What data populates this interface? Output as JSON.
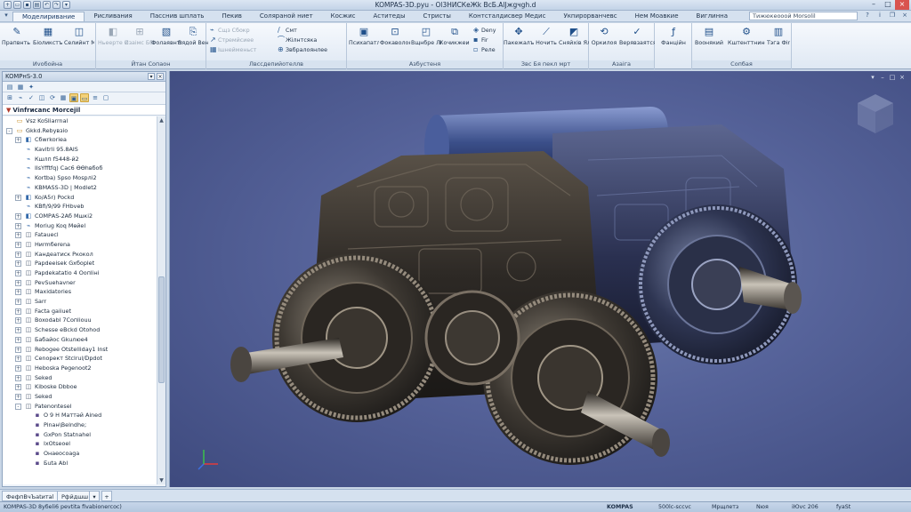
{
  "window": {
    "title": "KOMPAS-3D.pyu - Ol3HИСКеЖk BcБ.АlJжgчgh.d",
    "controls": [
      "minimize",
      "maximize",
      "close"
    ]
  },
  "ribbon": {
    "tabs": [
      "Моделиривание",
      "Рисливания",
      "Пасснив шплать",
      "Пекив",
      "Соляраной ниет",
      "Косжис",
      "Аститеды",
      "Стристы",
      "Контсталдисвер Медис",
      "Укпирорванчевс",
      "Нем Моавкие",
      "Виглинна"
    ],
    "active_tab": "Моделиривание",
    "search_placeholder": "Тижюкеооой Моrsolil",
    "groups": [
      {
        "caption": "Иvобойна",
        "buttons": [
          "Прапвнть Коницеснти",
          "Біоликстъ Орияд",
          "Селийнт Малятжа"
        ]
      },
      {
        "caption": "Йтан Сопаон",
        "buttons": [
          "Ньеерте Оипяис",
          "Изаімс Ббвкл",
          "Фолаявнтс Мажерс",
          "Вядой Венія"
        ]
      },
      {
        "caption": "Лвссдепийотеллв",
        "rows": [
          "Сщз Сбокр",
          "Стремйсиее",
          "Ішнейменьст",
          "Смт",
          "Жілнтсяка",
          "Звбралоянлее"
        ]
      },
      {
        "caption": "Азбустеня",
        "buttons": [
          "Психапатля Одитийс",
          "Фокаволок Фажевра",
          "Вщнбре Лідоос",
          "Кочикжеино Сланикора"
        ],
        "rows": [
          "Deny",
          "Fir",
          "Реле"
        ]
      },
      {
        "caption": "Звс Бя пекл мрт",
        "buttons": [
          "Пакежалъ Бялвалит",
          "Ночить",
          "Сняйхів Ялд"
        ]
      },
      {
        "caption": "Азаіга",
        "buttons": [
          "Оркилоя",
          "Верявзаятся Таменсне"
        ]
      },
      {
        "caption": "",
        "buttons": [
          "Фанційн"
        ]
      },
      {
        "caption": "Сопбая",
        "buttons": [
          "Воонякий",
          "Кштенттнинес",
          "Тэга Фіnu"
        ]
      }
    ]
  },
  "panel": {
    "title": "KOMPнS-3.0",
    "tree_header": "Vinfrиcanc Morcejil",
    "items": [
      {
        "label": "Vsz KoSIiarrnal",
        "level": 1,
        "expand": "",
        "icon": "folder-icon"
      },
      {
        "label": "Gkkd.Rebyвзio",
        "level": 1,
        "expand": "-",
        "icon": "folder-icon"
      },
      {
        "label": "Сбwrkoriea",
        "level": 2,
        "expand": "+",
        "icon": "part-icon"
      },
      {
        "label": "Kavitrli 95.8AIS",
        "level": 2,
        "expand": "",
        "icon": "sketch-icon"
      },
      {
        "label": "Кшлп f5448-й2",
        "level": 2,
        "expand": "",
        "icon": "sketch-icon"
      },
      {
        "label": "IIsYfftfq) Caс6 ӨӨhвбоб",
        "level": 2,
        "expand": "",
        "icon": "sketch-icon"
      },
      {
        "label": "Kortba) Spso Mosрлi2",
        "level": 2,
        "expand": "",
        "icon": "sketch-icon"
      },
      {
        "label": "KBMASS-3D | Modlet2",
        "level": 2,
        "expand": "",
        "icon": "sketch-icon"
      },
      {
        "label": "Ko/A5r) Pockd",
        "level": 2,
        "expand": "+",
        "icon": "part-icon"
      },
      {
        "label": "KBfi/9/99 FHbveb",
        "level": 2,
        "expand": "",
        "icon": "sketch-icon"
      },
      {
        "label": "СОМРАS-2Аб Мшкі2",
        "level": 2,
        "expand": "+",
        "icon": "part-icon"
      },
      {
        "label": "Моriug Koq Мөйеl",
        "level": 2,
        "expand": "+",
        "icon": "sketch-icon"
      },
      {
        "label": "Fatauecl",
        "level": 2,
        "expand": "+",
        "icon": "feature-icon"
      },
      {
        "label": "Hиrmбerena",
        "level": 2,
        "expand": "+",
        "icon": "feature-icon"
      },
      {
        "label": "Кандеатиск Ркокол",
        "level": 2,
        "expand": "+",
        "icon": "feature-icon"
      },
      {
        "label": "Papdeeisek Gxборlet",
        "level": 2,
        "expand": "+",
        "icon": "feature-icon"
      },
      {
        "label": "Papdekatatio 4 Оопliнi",
        "level": 2,
        "expand": "+",
        "icon": "feature-icon"
      },
      {
        "label": "PevSuehavner",
        "level": 2,
        "expand": "+",
        "icon": "feature-icon"
      },
      {
        "label": "Maxidatories",
        "level": 2,
        "expand": "+",
        "icon": "feature-icon"
      },
      {
        "label": "Sarr",
        "level": 2,
        "expand": "+",
        "icon": "feature-icon"
      },
      {
        "label": "Facta gaiiuet",
        "level": 2,
        "expand": "+",
        "icon": "feature-icon"
      },
      {
        "label": "Boxodabl 7Сопliouu",
        "level": 2,
        "expand": "+",
        "icon": "feature-icon"
      },
      {
        "label": "Schesse eBckd Otohod",
        "level": 2,
        "expand": "+",
        "icon": "feature-icon"
      },
      {
        "label": "Бабайос Gkuлюe4",
        "level": 2,
        "expand": "+",
        "icon": "feature-icon"
      },
      {
        "label": "Rebogee Otstelliday1 Inst",
        "level": 2,
        "expand": "+",
        "icon": "feature-icon"
      },
      {
        "label": "Сеnоpект Stclrul/Dpdot",
        "level": 2,
        "expand": "+",
        "icon": "feature-icon"
      },
      {
        "label": "Heboska Pegenoot2",
        "level": 2,
        "expand": "+",
        "icon": "feature-icon"
      },
      {
        "label": "Seked",
        "level": 2,
        "expand": "+",
        "icon": "feature-icon"
      },
      {
        "label": "Kiboske Dbboe",
        "level": 2,
        "expand": "+",
        "icon": "feature-icon"
      },
      {
        "label": "Seked",
        "level": 2,
        "expand": "+",
        "icon": "feature-icon"
      },
      {
        "label": "Patenontesel",
        "level": 2,
        "expand": "-",
        "icon": "feature-icon"
      },
      {
        "label": "О 9 Н Маттәй Ainеd",
        "level": 3,
        "expand": "",
        "icon": "body-icon"
      },
      {
        "label": "Pinaн\\Belndhe;",
        "level": 3,
        "expand": "",
        "icon": "body-icon"
      },
      {
        "label": "GxPon Statnahel",
        "level": 3,
        "expand": "",
        "icon": "body-icon"
      },
      {
        "label": "IxOtseoel",
        "level": 3,
        "expand": "",
        "icon": "body-icon"
      },
      {
        "label": "Онаеоcoaga",
        "level": 3,
        "expand": "",
        "icon": "body-icon"
      },
      {
        "label": "Бuta Abl",
        "level": 3,
        "expand": "",
        "icon": "body-icon"
      }
    ]
  },
  "doc_tabs": [
    "ФефпВчЪаtитаl",
    "Рфйдшш"
  ],
  "status": {
    "left": "KOMPAS-3D 8yбeli6 pevtita fivabionercoc)",
    "app": "KOMPAS",
    "right_items": [
      "500lc-sccvc",
      "Mpщлетз",
      "Nюя",
      "iЮvc 206",
      "fyаSt"
    ]
  },
  "colors": {
    "ribbon_bg": "#e4ecf6",
    "viewport_bg": "#56639a",
    "accent": "#1f4f8a"
  }
}
